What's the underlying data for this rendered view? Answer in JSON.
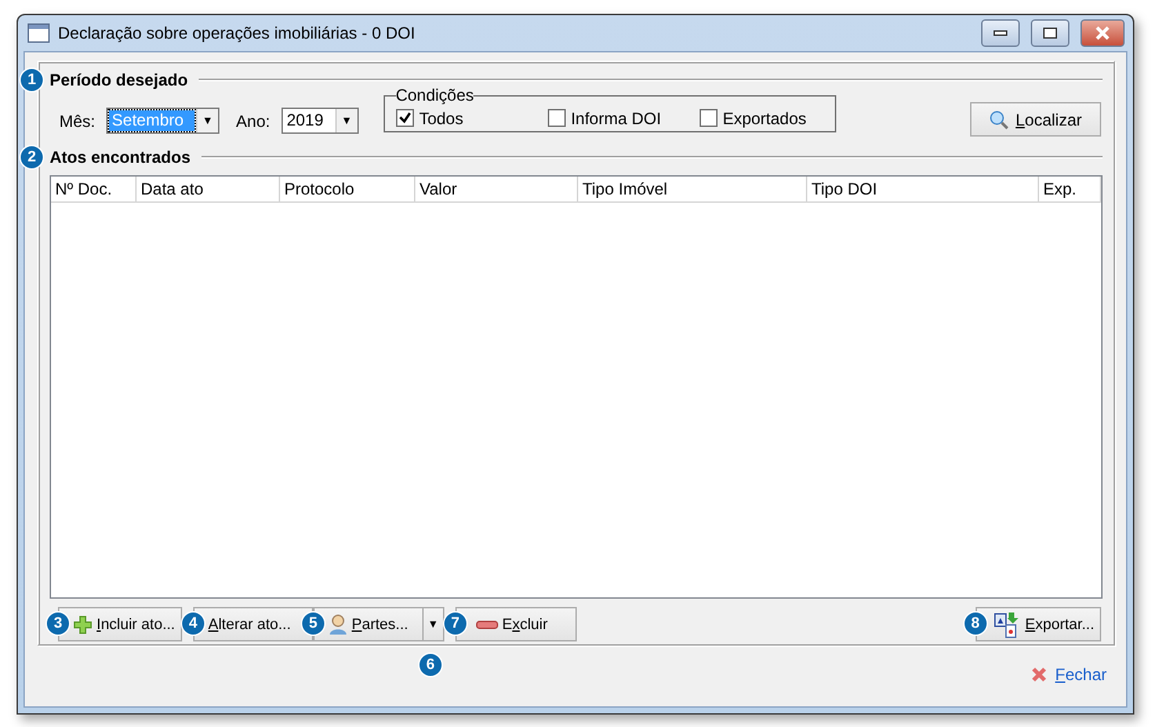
{
  "window": {
    "title": "Declaração sobre operações imobiliárias - 0 DOI"
  },
  "period": {
    "badge": "1",
    "heading": "Período desejado",
    "month_label": "Mês:",
    "month": "Setembro",
    "year_label": "Ano:",
    "year": "2019",
    "dropdown_arrow": "▼",
    "conditions": {
      "legend": "Condições",
      "options": [
        {
          "label": "Todos",
          "checked": true
        },
        {
          "label": "Informa DOI",
          "checked": false
        },
        {
          "label": "Exportados",
          "checked": false
        }
      ]
    },
    "search_button": {
      "label": "Localizar"
    }
  },
  "results": {
    "badge": "2",
    "heading": "Atos encontrados",
    "table": {
      "columns": [
        "Nº Doc.",
        "Data ato",
        "Protocolo",
        "Valor",
        "Tipo Imóvel",
        "Tipo DOI",
        "Exp."
      ]
    }
  },
  "buttons": [
    {
      "kind": "add",
      "label": "Incluir ato...",
      "badge": "3"
    },
    {
      "kind": "edit",
      "label": "Alterar ato...",
      "badge": "4"
    },
    {
      "kind": "split",
      "label": "Partes...",
      "badge": "5",
      "arrow": "▼",
      "arrow_badge": "6"
    },
    {
      "kind": "delete",
      "label": "Excluir",
      "badge": "7"
    },
    {
      "kind": "export",
      "label": "Exportar...",
      "badge": "8"
    }
  ],
  "close_link": {
    "label": "Fechar"
  }
}
